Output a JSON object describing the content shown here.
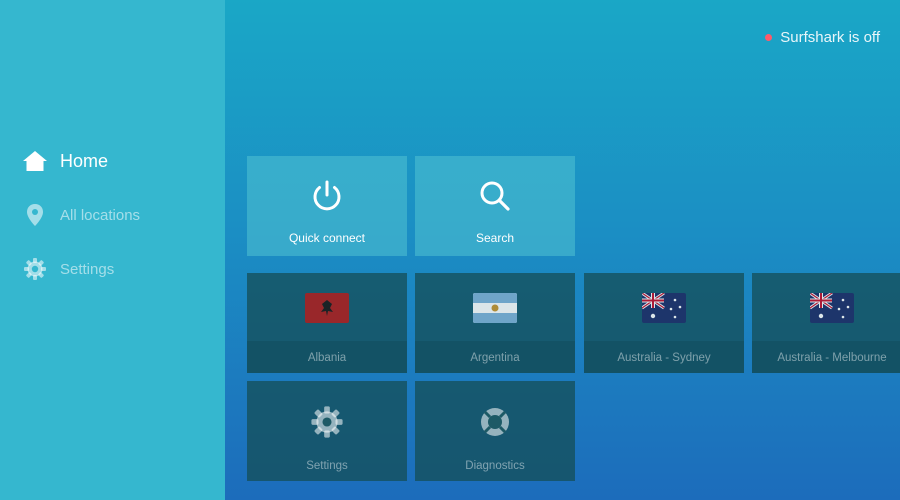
{
  "sidebar": {
    "items": [
      {
        "label": "Home",
        "icon": "home-icon",
        "active": true
      },
      {
        "label": "All locations",
        "icon": "location-pin-icon",
        "active": false
      },
      {
        "label": "Settings",
        "icon": "gear-icon",
        "active": false
      }
    ]
  },
  "status": {
    "text": "Surfshark is off",
    "dot_color": "#ff5a6a"
  },
  "actions": [
    {
      "label": "Quick connect",
      "icon": "power-icon"
    },
    {
      "label": "Search",
      "icon": "search-icon"
    }
  ],
  "locations": [
    {
      "label": "Albania",
      "icon": "albania-flag-icon"
    },
    {
      "label": "Argentina",
      "icon": "argentina-flag-icon"
    },
    {
      "label": "Australia - Sydney",
      "icon": "australia-flag-icon"
    },
    {
      "label": "Australia - Melbourne",
      "icon": "australia-flag-icon"
    }
  ],
  "utilities": [
    {
      "label": "Settings",
      "icon": "gear-icon"
    },
    {
      "label": "Diagnostics",
      "icon": "lifebuoy-icon"
    }
  ],
  "colors": {
    "background_top": "#1aa7c6",
    "background_bottom": "#1c6cbb",
    "sidebar": "#35b7cf"
  }
}
